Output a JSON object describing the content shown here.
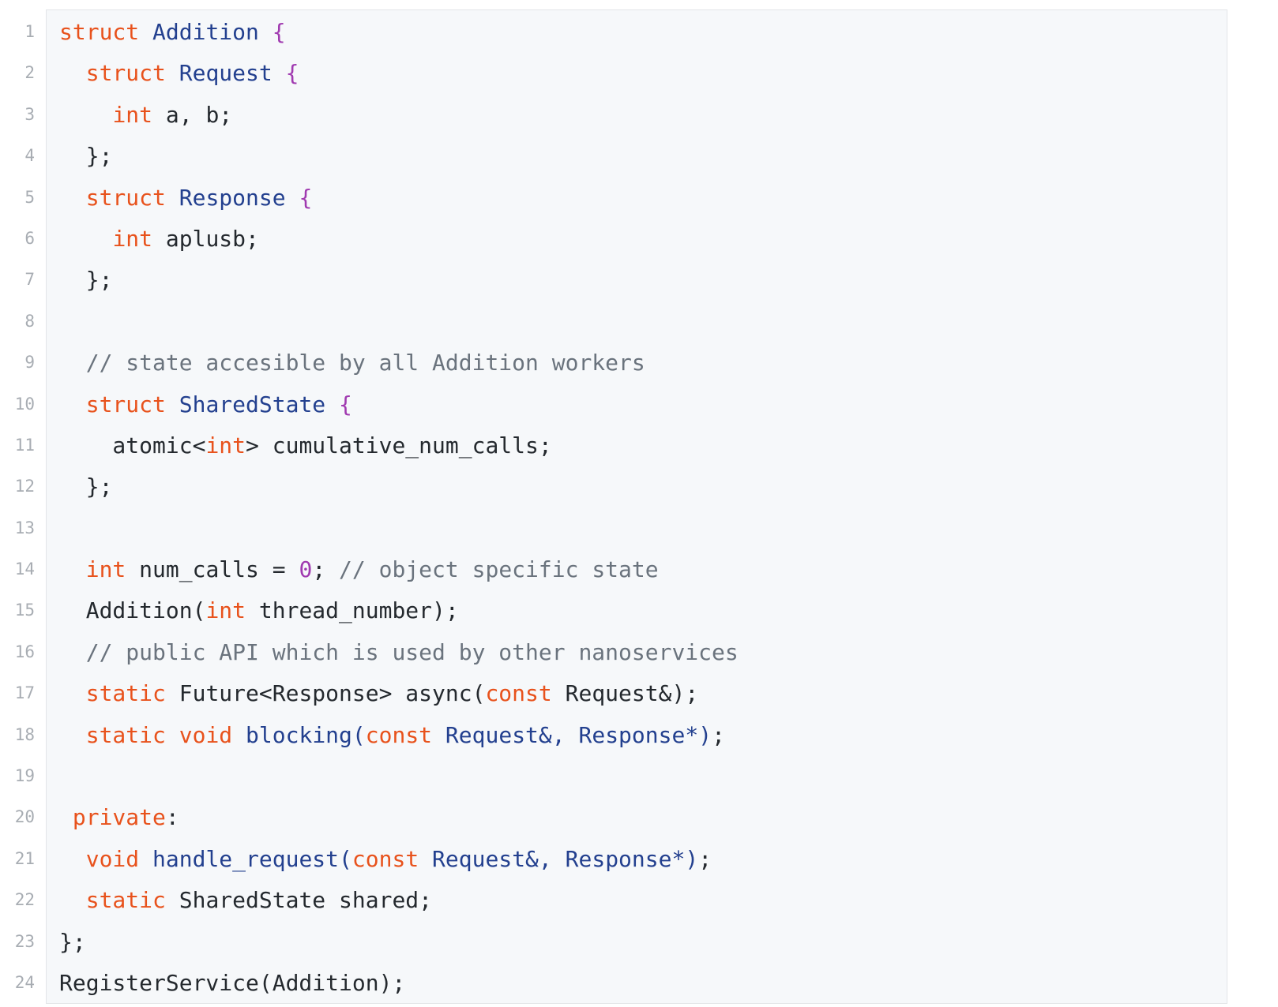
{
  "editor": {
    "colors": {
      "keyword": "#e8521c",
      "type": "#23408f",
      "brace": "#a03ab0",
      "number": "#a03ab0",
      "comment": "#6a737d",
      "text": "#24292e",
      "line_number": "#a8adb3",
      "background": "#f6f8fa"
    },
    "lines": [
      {
        "n": "1",
        "tokens": [
          [
            "kw",
            "struct"
          ],
          [
            "tx",
            " "
          ],
          [
            "ty",
            "Addition"
          ],
          [
            "tx",
            " "
          ],
          [
            "br",
            "{"
          ]
        ]
      },
      {
        "n": "2",
        "tokens": [
          [
            "tx",
            "  "
          ],
          [
            "kw",
            "struct"
          ],
          [
            "tx",
            " "
          ],
          [
            "ty",
            "Request"
          ],
          [
            "tx",
            " "
          ],
          [
            "br",
            "{"
          ]
        ]
      },
      {
        "n": "3",
        "tokens": [
          [
            "tx",
            "    "
          ],
          [
            "kw",
            "int"
          ],
          [
            "tx",
            " a, b;"
          ]
        ]
      },
      {
        "n": "4",
        "tokens": [
          [
            "tx",
            "  };"
          ]
        ]
      },
      {
        "n": "5",
        "tokens": [
          [
            "tx",
            "  "
          ],
          [
            "kw",
            "struct"
          ],
          [
            "tx",
            " "
          ],
          [
            "ty",
            "Response"
          ],
          [
            "tx",
            " "
          ],
          [
            "br",
            "{"
          ]
        ]
      },
      {
        "n": "6",
        "tokens": [
          [
            "tx",
            "    "
          ],
          [
            "kw",
            "int"
          ],
          [
            "tx",
            " aplusb;"
          ]
        ]
      },
      {
        "n": "7",
        "tokens": [
          [
            "tx",
            "  };"
          ]
        ]
      },
      {
        "n": "8",
        "tokens": [
          [
            "tx",
            ""
          ]
        ]
      },
      {
        "n": "9",
        "tokens": [
          [
            "tx",
            "  "
          ],
          [
            "cm",
            "// state accesible by all Addition workers"
          ]
        ]
      },
      {
        "n": "10",
        "tokens": [
          [
            "tx",
            "  "
          ],
          [
            "kw",
            "struct"
          ],
          [
            "tx",
            " "
          ],
          [
            "ty",
            "SharedState"
          ],
          [
            "tx",
            " "
          ],
          [
            "br",
            "{"
          ]
        ]
      },
      {
        "n": "11",
        "tokens": [
          [
            "tx",
            "    atomic<"
          ],
          [
            "kw",
            "int"
          ],
          [
            "tx",
            "> cumulative_num_calls;"
          ]
        ]
      },
      {
        "n": "12",
        "tokens": [
          [
            "tx",
            "  };"
          ]
        ]
      },
      {
        "n": "13",
        "tokens": [
          [
            "tx",
            ""
          ]
        ]
      },
      {
        "n": "14",
        "tokens": [
          [
            "tx",
            "  "
          ],
          [
            "kw",
            "int"
          ],
          [
            "tx",
            " num_calls = "
          ],
          [
            "num",
            "0"
          ],
          [
            "tx",
            "; "
          ],
          [
            "cm",
            "// object specific state"
          ]
        ]
      },
      {
        "n": "15",
        "tokens": [
          [
            "tx",
            "  Addition("
          ],
          [
            "kw",
            "int"
          ],
          [
            "tx",
            " thread_number);"
          ]
        ]
      },
      {
        "n": "16",
        "tokens": [
          [
            "tx",
            "  "
          ],
          [
            "cm",
            "// public API which is used by other nanoservices"
          ]
        ]
      },
      {
        "n": "17",
        "tokens": [
          [
            "tx",
            "  "
          ],
          [
            "kw",
            "static"
          ],
          [
            "tx",
            " Future<Response> async("
          ],
          [
            "kw",
            "const"
          ],
          [
            "tx",
            " Request&);"
          ]
        ]
      },
      {
        "n": "18",
        "tokens": [
          [
            "tx",
            "  "
          ],
          [
            "kw",
            "static"
          ],
          [
            "tx",
            " "
          ],
          [
            "kw",
            "void"
          ],
          [
            "tx",
            " "
          ],
          [
            "ty",
            "blocking("
          ],
          [
            "kw",
            "const"
          ],
          [
            "tx",
            " "
          ],
          [
            "ty",
            "Request&, Response*)"
          ],
          [
            "tx",
            ";"
          ]
        ]
      },
      {
        "n": "19",
        "tokens": [
          [
            "tx",
            ""
          ]
        ]
      },
      {
        "n": "20",
        "tokens": [
          [
            "tx",
            " "
          ],
          [
            "kw",
            "private"
          ],
          [
            "tx",
            ":"
          ]
        ]
      },
      {
        "n": "21",
        "tokens": [
          [
            "tx",
            "  "
          ],
          [
            "kw",
            "void"
          ],
          [
            "tx",
            " "
          ],
          [
            "ty",
            "handle_request("
          ],
          [
            "kw",
            "const"
          ],
          [
            "tx",
            " "
          ],
          [
            "ty",
            "Request&, Response*)"
          ],
          [
            "tx",
            ";"
          ]
        ]
      },
      {
        "n": "22",
        "tokens": [
          [
            "tx",
            "  "
          ],
          [
            "kw",
            "static"
          ],
          [
            "tx",
            " SharedState shared;"
          ]
        ]
      },
      {
        "n": "23",
        "tokens": [
          [
            "tx",
            "};"
          ]
        ]
      },
      {
        "n": "24",
        "tokens": [
          [
            "tx",
            "RegisterService(Addition);"
          ]
        ]
      }
    ]
  }
}
